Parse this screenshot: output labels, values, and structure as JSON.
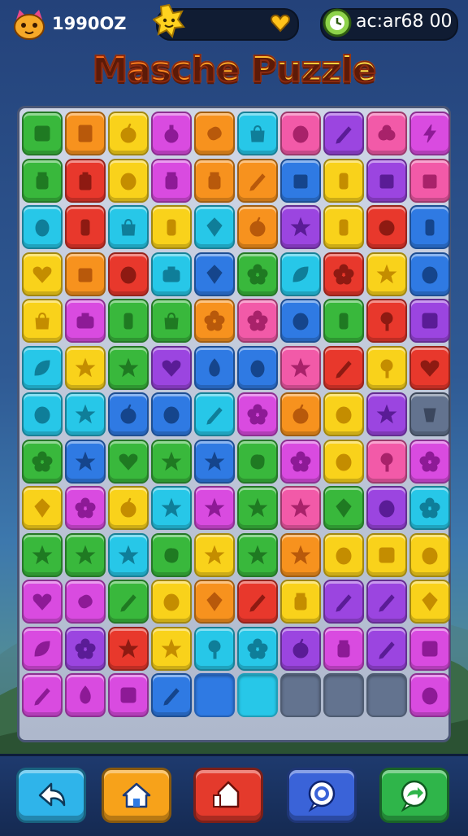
{
  "header": {
    "score": "1990OZ",
    "timer": "ac:ar68 00",
    "colors": {
      "bar": "#101c33"
    }
  },
  "title": {
    "text": "Masche Puzzle",
    "colors": {
      "left": "#ff7a1c",
      "right": "#ffd23a"
    }
  },
  "board": {
    "palette": {
      "G": "#39b83c",
      "O": "#f7921e",
      "Y": "#f9d21b",
      "M": "#d94be0",
      "C": "#27c7e8",
      "P": "#9b45e0",
      "R": "#e8382c",
      "B": "#2f7ae3",
      "K": "#f25aa8",
      "E": "#63738f"
    },
    "shape_colors": {
      "G": "#1f7a22",
      "O": "#b8590b",
      "Y": "#c48d00",
      "M": "#8d1a96",
      "C": "#0f7e99",
      "P": "#5a1c96",
      "R": "#8e1a12",
      "B": "#15458c",
      "K": "#a8226a",
      "E": "#3b475e"
    },
    "rows": [
      [
        {
          "c": "G",
          "s": "card"
        },
        {
          "c": "O",
          "s": "calculator"
        },
        {
          "c": "Y",
          "s": "fruit"
        },
        {
          "c": "M",
          "s": "potion"
        },
        {
          "c": "O",
          "s": "candy"
        },
        {
          "c": "C",
          "s": "bag"
        },
        {
          "c": "K",
          "s": "gummy"
        },
        {
          "c": "P",
          "s": "pencil"
        },
        {
          "c": "K",
          "s": "berries"
        },
        {
          "c": "M",
          "s": "bolt"
        }
      ],
      [
        {
          "c": "G",
          "s": "jar"
        },
        {
          "c": "R",
          "s": "battery"
        },
        {
          "c": "Y",
          "s": "gummy"
        },
        {
          "c": "M",
          "s": "jar"
        },
        {
          "c": "O",
          "s": "jar"
        },
        {
          "c": "O",
          "s": "pencil"
        },
        {
          "c": "B",
          "s": "box"
        },
        {
          "c": "Y",
          "s": "bottle"
        },
        {
          "c": "P",
          "s": "box"
        },
        {
          "c": "K",
          "s": "box"
        }
      ],
      [
        {
          "c": "C",
          "s": "lemon"
        },
        {
          "c": "R",
          "s": "bottle"
        },
        {
          "c": "C",
          "s": "bag"
        },
        {
          "c": "Y",
          "s": "bottle"
        },
        {
          "c": "C",
          "s": "gem"
        },
        {
          "c": "O",
          "s": "fruit"
        },
        {
          "c": "P",
          "s": "star"
        },
        {
          "c": "Y",
          "s": "bottle"
        },
        {
          "c": "R",
          "s": "berry"
        },
        {
          "c": "B",
          "s": "bottle"
        }
      ],
      [
        {
          "c": "Y",
          "s": "heart"
        },
        {
          "c": "O",
          "s": "box"
        },
        {
          "c": "R",
          "s": "gummy"
        },
        {
          "c": "C",
          "s": "camera"
        },
        {
          "c": "B",
          "s": "gem"
        },
        {
          "c": "G",
          "s": "flower"
        },
        {
          "c": "C",
          "s": "leaf"
        },
        {
          "c": "R",
          "s": "flower"
        },
        {
          "c": "Y",
          "s": "star"
        },
        {
          "c": "B",
          "s": "gummy"
        }
      ],
      [
        {
          "c": "Y",
          "s": "bag"
        },
        {
          "c": "M",
          "s": "camera"
        },
        {
          "c": "G",
          "s": "bottle"
        },
        {
          "c": "G",
          "s": "bag"
        },
        {
          "c": "O",
          "s": "flower"
        },
        {
          "c": "K",
          "s": "flower"
        },
        {
          "c": "B",
          "s": "gummy"
        },
        {
          "c": "G",
          "s": "bottle"
        },
        {
          "c": "R",
          "s": "lolly"
        },
        {
          "c": "P",
          "s": "card"
        }
      ],
      [
        {
          "c": "C",
          "s": "leaf"
        },
        {
          "c": "Y",
          "s": "star"
        },
        {
          "c": "G",
          "s": "star"
        },
        {
          "c": "P",
          "s": "heart"
        },
        {
          "c": "B",
          "s": "flame"
        },
        {
          "c": "B",
          "s": "lemon"
        },
        {
          "c": "K",
          "s": "star"
        },
        {
          "c": "R",
          "s": "pencil"
        },
        {
          "c": "Y",
          "s": "lolly"
        },
        {
          "c": "R",
          "s": "heart"
        }
      ],
      [
        {
          "c": "C",
          "s": "gummy"
        },
        {
          "c": "C",
          "s": "star"
        },
        {
          "c": "B",
          "s": "fruit"
        },
        {
          "c": "B",
          "s": "gummy"
        },
        {
          "c": "C",
          "s": "pencil"
        },
        {
          "c": "M",
          "s": "flower"
        },
        {
          "c": "O",
          "s": "fruit"
        },
        {
          "c": "Y",
          "s": "gummy"
        },
        {
          "c": "P",
          "s": "star"
        },
        {
          "c": "E",
          "s": "cup"
        }
      ],
      [
        {
          "c": "G",
          "s": "flower"
        },
        {
          "c": "B",
          "s": "star"
        },
        {
          "c": "G",
          "s": "heart"
        },
        {
          "c": "G",
          "s": "star"
        },
        {
          "c": "B",
          "s": "star"
        },
        {
          "c": "G",
          "s": "blob"
        },
        {
          "c": "M",
          "s": "flower"
        },
        {
          "c": "Y",
          "s": "gummy"
        },
        {
          "c": "K",
          "s": "lolly"
        },
        {
          "c": "M",
          "s": "flower"
        }
      ],
      [
        {
          "c": "Y",
          "s": "gem"
        },
        {
          "c": "M",
          "s": "flower"
        },
        {
          "c": "Y",
          "s": "fruit"
        },
        {
          "c": "C",
          "s": "star"
        },
        {
          "c": "M",
          "s": "star"
        },
        {
          "c": "G",
          "s": "star"
        },
        {
          "c": "K",
          "s": "star"
        },
        {
          "c": "G",
          "s": "gem"
        },
        {
          "c": "P",
          "s": "gummy"
        },
        {
          "c": "C",
          "s": "flower"
        }
      ],
      [
        {
          "c": "G",
          "s": "star"
        },
        {
          "c": "G",
          "s": "star"
        },
        {
          "c": "C",
          "s": "star"
        },
        {
          "c": "G",
          "s": "blob"
        },
        {
          "c": "Y",
          "s": "star"
        },
        {
          "c": "G",
          "s": "star"
        },
        {
          "c": "O",
          "s": "star"
        },
        {
          "c": "Y",
          "s": "gummy"
        },
        {
          "c": "Y",
          "s": "card"
        },
        {
          "c": "Y",
          "s": "gummy"
        }
      ],
      [
        {
          "c": "M",
          "s": "heart"
        },
        {
          "c": "M",
          "s": "candy"
        },
        {
          "c": "G",
          "s": "pencil"
        },
        {
          "c": "Y",
          "s": "gummy"
        },
        {
          "c": "O",
          "s": "gem"
        },
        {
          "c": "R",
          "s": "pencil"
        },
        {
          "c": "Y",
          "s": "jar"
        },
        {
          "c": "P",
          "s": "pencil"
        },
        {
          "c": "P",
          "s": "pencil"
        },
        {
          "c": "Y",
          "s": "gem"
        }
      ],
      [
        {
          "c": "M",
          "s": "leaf"
        },
        {
          "c": "P",
          "s": "flower"
        },
        {
          "c": "R",
          "s": "star"
        },
        {
          "c": "Y",
          "s": "star"
        },
        {
          "c": "C",
          "s": "lolly"
        },
        {
          "c": "C",
          "s": "flower"
        },
        {
          "c": "P",
          "s": "fruit"
        },
        {
          "c": "M",
          "s": "jar"
        },
        {
          "c": "P",
          "s": "pencil"
        },
        {
          "c": "M",
          "s": "card"
        }
      ],
      [
        {
          "c": "M",
          "s": "pencil"
        },
        {
          "c": "M",
          "s": "flame"
        },
        {
          "c": "M",
          "s": "card"
        },
        {
          "c": "B",
          "s": "pencil"
        },
        {
          "c": "B",
          "s": "none"
        },
        {
          "c": "C",
          "s": "none"
        },
        {
          "c": "E",
          "s": "none"
        },
        {
          "c": "E",
          "s": "none"
        },
        {
          "c": "E",
          "s": "none"
        },
        {
          "c": "M",
          "s": "gummy"
        }
      ]
    ]
  },
  "bottom_bar": {
    "buttons": [
      {
        "name": "back-button",
        "icon": "back-arrow-icon",
        "color": "#2fb4ea"
      },
      {
        "name": "home-button",
        "icon": "home-icon",
        "color": "#f7a21a"
      },
      {
        "name": "restart-button",
        "icon": "house-up-icon",
        "color": "#e43a2c"
      },
      {
        "name": "chat-button",
        "icon": "chat-bubble-icon",
        "color": "#3a63d8"
      },
      {
        "name": "share-button",
        "icon": "share-bubble-icon",
        "color": "#2fb54a"
      }
    ]
  }
}
